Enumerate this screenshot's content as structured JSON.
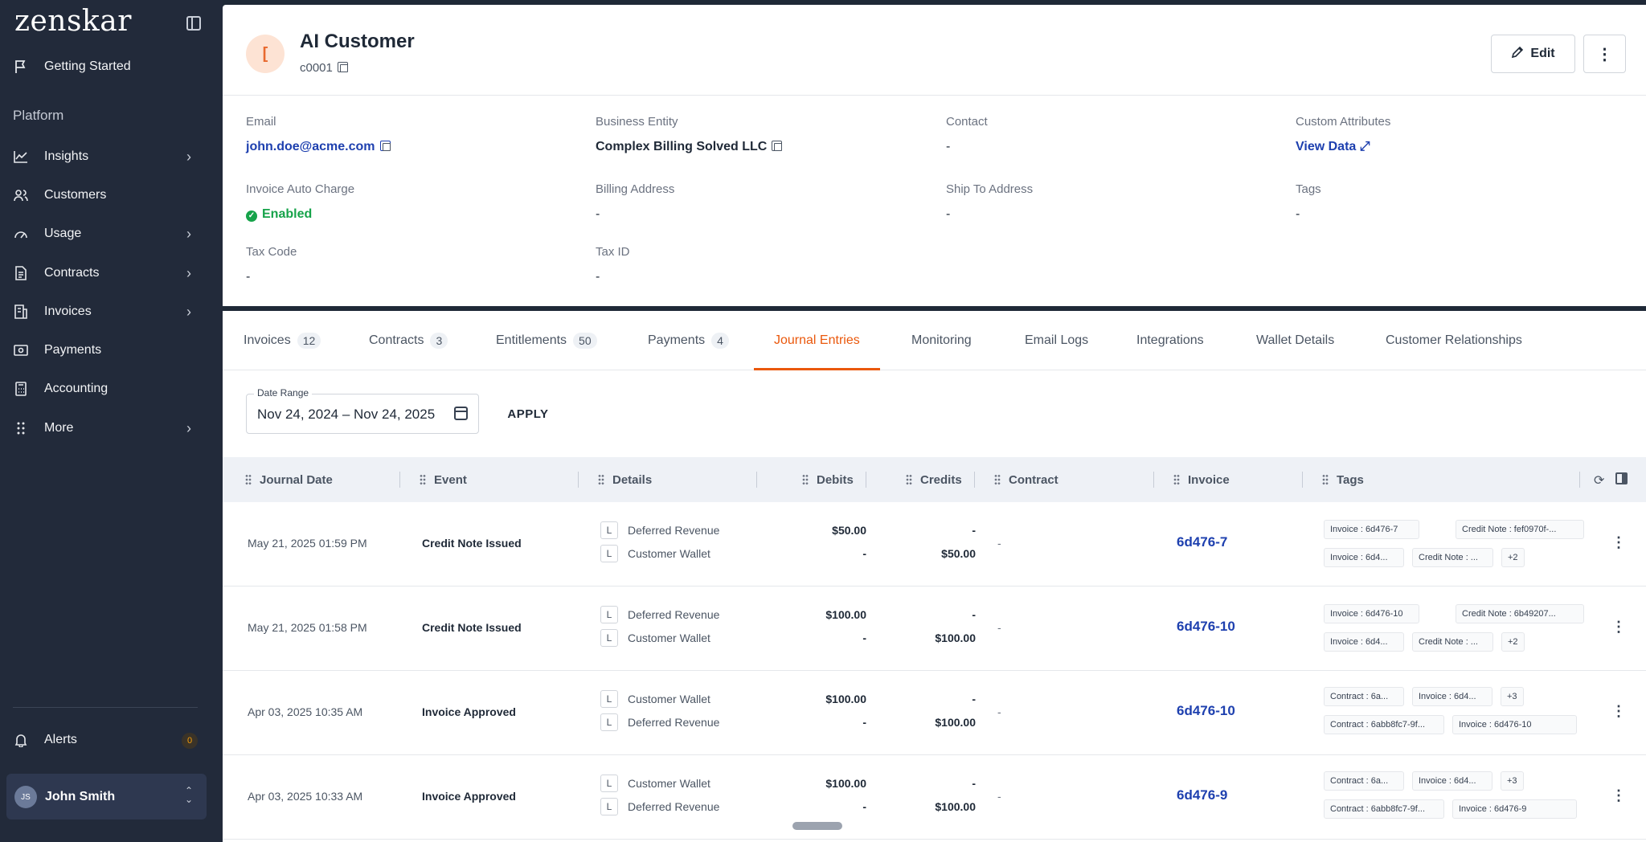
{
  "app": {
    "logo": "zenskar",
    "getting_started": "Getting Started",
    "section_platform": "Platform",
    "nav": [
      {
        "label": "Insights",
        "icon": "chart-icon",
        "has_submenu": true
      },
      {
        "label": "Customers",
        "icon": "users-icon",
        "has_submenu": false
      },
      {
        "label": "Usage",
        "icon": "gauge-icon",
        "has_submenu": true
      },
      {
        "label": "Contracts",
        "icon": "document-icon",
        "has_submenu": true
      },
      {
        "label": "Invoices",
        "icon": "invoice-icon",
        "has_submenu": true
      },
      {
        "label": "Payments",
        "icon": "money-icon",
        "has_submenu": false
      },
      {
        "label": "Accounting",
        "icon": "calculator-icon",
        "has_submenu": false
      },
      {
        "label": "More",
        "icon": "dots-grid-icon",
        "has_submenu": true
      }
    ],
    "alerts_label": "Alerts",
    "alerts_count": "0",
    "user": {
      "initials": "JS",
      "name": "John Smith"
    }
  },
  "customer": {
    "initial": "[",
    "name": "AI Customer",
    "id": "c0001",
    "edit_label": "Edit",
    "fields": {
      "email": {
        "label": "Email",
        "value": "john.doe@acme.com"
      },
      "business_entity": {
        "label": "Business Entity",
        "value": "Complex Billing Solved LLC"
      },
      "contact": {
        "label": "Contact",
        "value": "-"
      },
      "custom_attributes": {
        "label": "Custom Attributes",
        "value": "View Data"
      },
      "invoice_auto_charge": {
        "label": "Invoice Auto Charge",
        "value": "Enabled"
      },
      "billing_address": {
        "label": "Billing Address",
        "value": "-"
      },
      "ship_to_address": {
        "label": "Ship To Address",
        "value": "-"
      },
      "tags": {
        "label": "Tags",
        "value": "-"
      },
      "tax_code": {
        "label": "Tax Code",
        "value": "-"
      },
      "tax_id": {
        "label": "Tax ID",
        "value": "-"
      }
    }
  },
  "tabs": [
    {
      "label": "Invoices",
      "count": "12"
    },
    {
      "label": "Contracts",
      "count": "3"
    },
    {
      "label": "Entitlements",
      "count": "50"
    },
    {
      "label": "Payments",
      "count": "4"
    },
    {
      "label": "Journal Entries",
      "count": "",
      "active": true
    },
    {
      "label": "Monitoring",
      "count": ""
    },
    {
      "label": "Email Logs",
      "count": ""
    },
    {
      "label": "Integrations",
      "count": ""
    },
    {
      "label": "Wallet Details",
      "count": ""
    },
    {
      "label": "Customer Relationships",
      "count": ""
    }
  ],
  "filter": {
    "date_range_label": "Date Range",
    "date_range_value": "Nov 24, 2024 –   Nov 24, 2025",
    "apply_label": "APPLY"
  },
  "table": {
    "columns": [
      "Journal Date",
      "Event",
      "Details",
      "Debits",
      "Credits",
      "Contract",
      "Invoice",
      "Tags"
    ],
    "rows": [
      {
        "date": "May 21, 2025 01:59 PM",
        "event": "Credit Note Issued",
        "accounts": [
          {
            "badge": "L",
            "name": "Deferred Revenue"
          },
          {
            "badge": "L",
            "name": "Customer Wallet"
          }
        ],
        "debits": [
          "$50.00",
          "-"
        ],
        "credits": [
          "-",
          "$50.00"
        ],
        "contract": "-",
        "invoice": "6d476-7",
        "tags": [
          "Invoice : 6d476-7",
          "Credit Note : fef0970f-...",
          "Invoice : 6d4...",
          "Credit Note : ...",
          "+2"
        ]
      },
      {
        "date": "May 21, 2025 01:58 PM",
        "event": "Credit Note Issued",
        "accounts": [
          {
            "badge": "L",
            "name": "Deferred Revenue"
          },
          {
            "badge": "L",
            "name": "Customer Wallet"
          }
        ],
        "debits": [
          "$100.00",
          "-"
        ],
        "credits": [
          "-",
          "$100.00"
        ],
        "contract": "-",
        "invoice": "6d476-10",
        "tags": [
          "Invoice : 6d476-10",
          "Credit Note : 6b49207...",
          "Invoice : 6d4...",
          "Credit Note : ...",
          "+2"
        ]
      },
      {
        "date": "Apr 03, 2025 10:35 AM",
        "event": "Invoice Approved",
        "accounts": [
          {
            "badge": "L",
            "name": "Customer Wallet"
          },
          {
            "badge": "L",
            "name": "Deferred Revenue"
          }
        ],
        "debits": [
          "$100.00",
          "-"
        ],
        "credits": [
          "-",
          "$100.00"
        ],
        "contract": "-",
        "invoice": "6d476-10",
        "tags": [
          "Contract : 6a...",
          "Invoice : 6d4...",
          "+3",
          "Contract : 6abb8fc7-9f...",
          "Invoice : 6d476-10"
        ]
      },
      {
        "date": "Apr 03, 2025 10:33 AM",
        "event": "Invoice Approved",
        "accounts": [
          {
            "badge": "L",
            "name": "Customer Wallet"
          },
          {
            "badge": "L",
            "name": "Deferred Revenue"
          }
        ],
        "debits": [
          "$100.00",
          "-"
        ],
        "credits": [
          "-",
          "$100.00"
        ],
        "contract": "-",
        "invoice": "6d476-9",
        "tags": [
          "Contract : 6a...",
          "Invoice : 6d4...",
          "+3",
          "Contract : 6abb8fc7-9f...",
          "Invoice : 6d476-9"
        ]
      }
    ]
  }
}
